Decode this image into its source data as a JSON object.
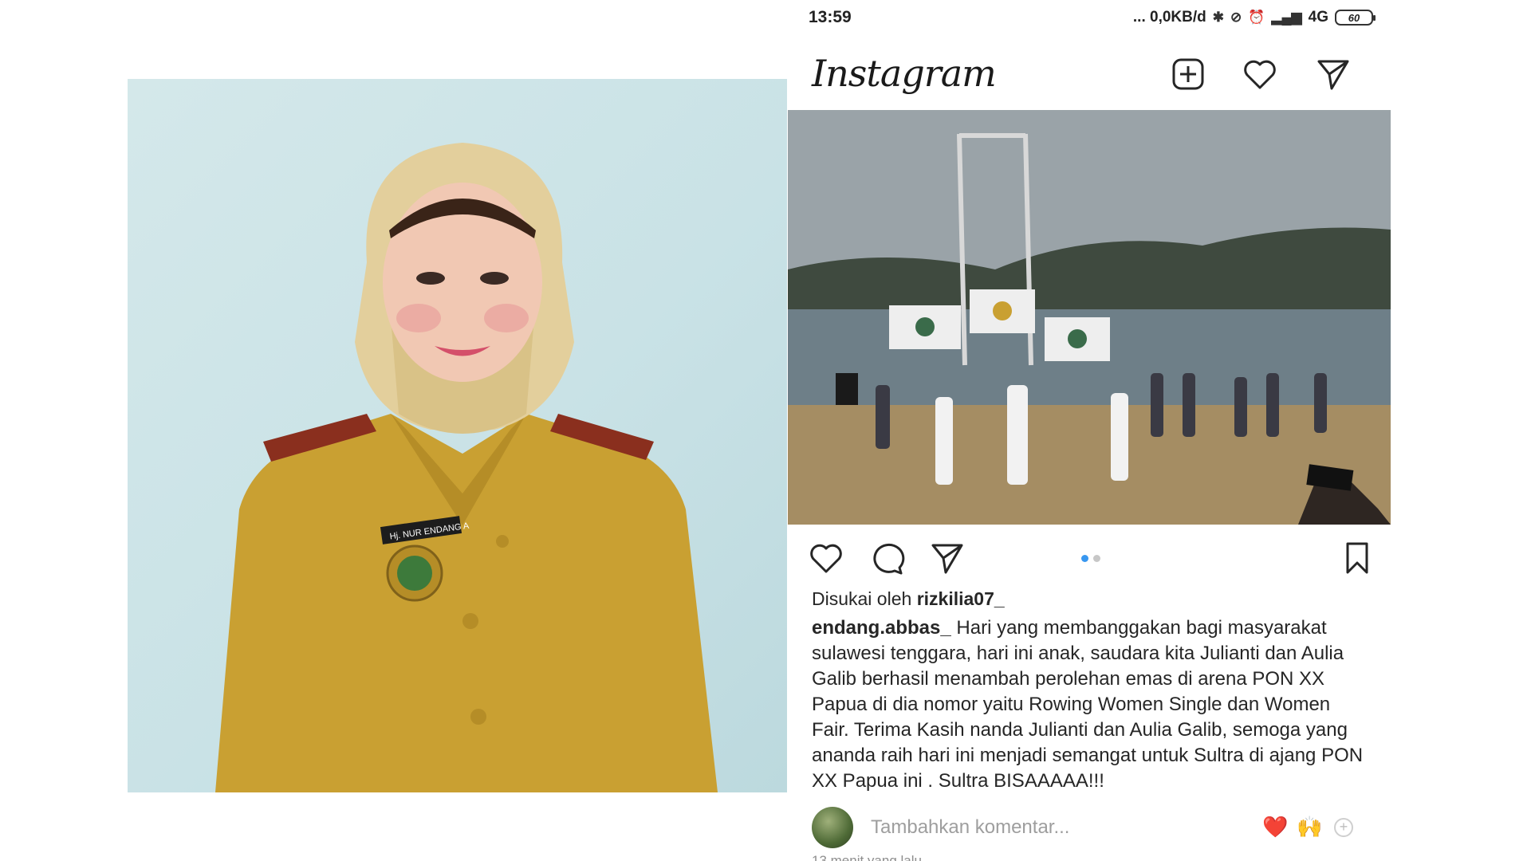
{
  "status_bar": {
    "time": "13:59",
    "indicators": "... 0,0KB/d",
    "network": "4G",
    "battery": "60"
  },
  "header": {
    "logo": "Instagram",
    "icons": [
      "new-post-icon",
      "heart-icon",
      "direct-message-icon"
    ]
  },
  "post": {
    "carousel": {
      "count": 2,
      "active_index": 0
    },
    "liked_by_prefix": "Disukai oleh",
    "liked_by_user": "rizkilia07_",
    "caption_user": "endang.abbas_",
    "caption_text": "Hari yang membanggakan bagi masyarakat sulawesi tenggara, hari ini anak, saudara kita Julianti dan Aulia Galib berhasil menambah perolehan emas di arena PON XX Papua di dia nomor yaitu Rowing Women Single dan Women Fair. Terima Kasih nanda Julianti dan Aulia Galib, semoga yang ananda raih hari ini menjadi semangat untuk Sultra di ajang PON XX Papua ini . Sultra BISAAAAA!!!",
    "comment_placeholder": "Tambahkan komentar...",
    "quick_reactions": [
      "❤️",
      "🙌"
    ],
    "timestamp": "13 menit yang lalu"
  },
  "portrait": {
    "name_tag": "Hj. NUR ENDANG A"
  },
  "colors": {
    "uniform": "#c9a032",
    "hijab": "#e3cf9c",
    "portrait_bg": "#cfe5e8",
    "link_blue": "#3897f0",
    "heart_red": "#ed4956"
  }
}
